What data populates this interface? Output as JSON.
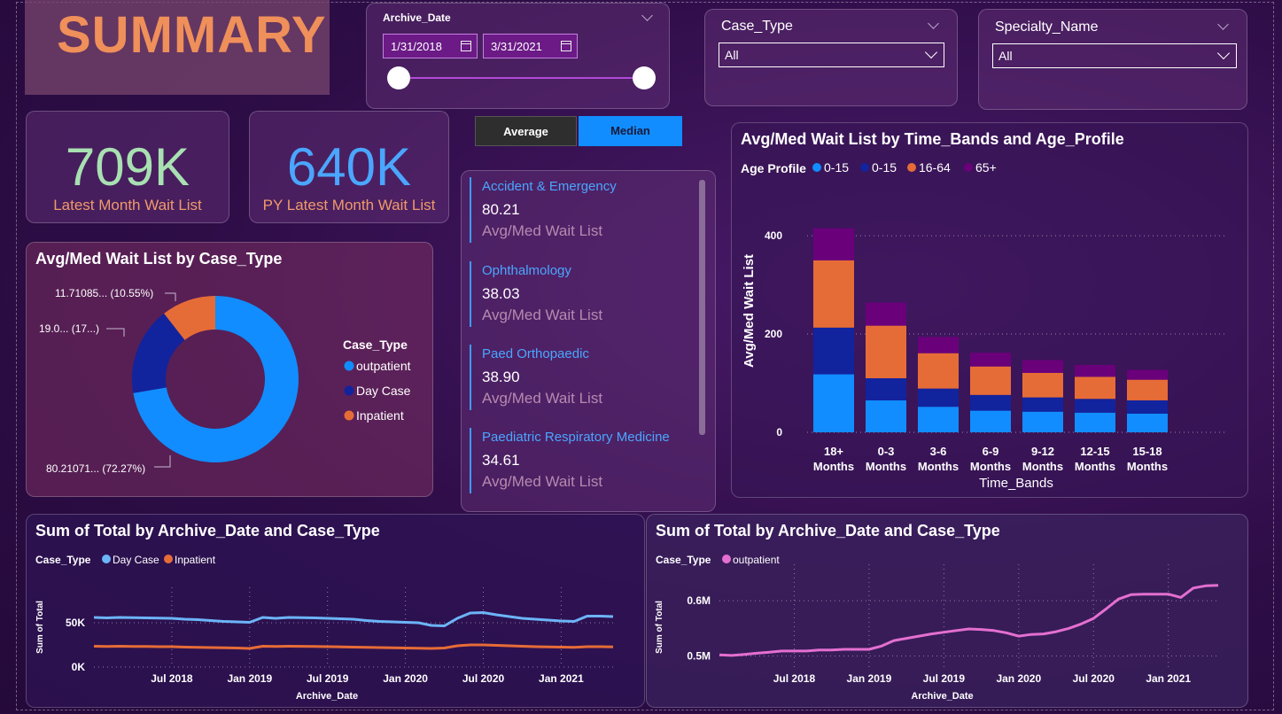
{
  "header": {
    "title": "SUMMARY"
  },
  "archive_slicer": {
    "title": "Archive_Date",
    "start": "1/31/2018",
    "end": "3/31/2021"
  },
  "case_type_slicer": {
    "title": "Case_Type",
    "value": "All"
  },
  "specialty_slicer": {
    "title": "Specialty_Name",
    "value": "All"
  },
  "kpis": [
    {
      "value": "709K",
      "label": "Latest Month Wait List",
      "color": "#a8e0b2"
    },
    {
      "value": "640K",
      "label": "PY Latest Month Wait List",
      "color": "#4aa6ff"
    }
  ],
  "toggle": {
    "average": "Average",
    "median": "Median"
  },
  "specialties": [
    {
      "name": "Accident & Emergency",
      "value": "80.21",
      "label": "Avg/Med Wait List"
    },
    {
      "name": "Ophthalmology",
      "value": "38.03",
      "label": "Avg/Med Wait List"
    },
    {
      "name": "Paed Orthopaedic",
      "value": "38.90",
      "label": "Avg/Med Wait List"
    },
    {
      "name": "Paediatric Respiratory Medicine",
      "value": "34.61",
      "label": "Avg/Med Wait List"
    }
  ],
  "colors": {
    "outpatient": "#118dff",
    "daycase": "#12239e",
    "inpatient": "#e66c37",
    "age65": "#6b007b",
    "daycase_line": "#6cb4f8",
    "outpatient_line": "#e46fd0"
  },
  "chart_data": [
    {
      "type": "pie",
      "title": "Avg/Med Wait List by Case_Type",
      "legend_title": "Case_Type",
      "legend_placement": "right",
      "slices": [
        {
          "name": "outpatient",
          "value": 80.21071,
          "label": "80.21071... (72.27%)"
        },
        {
          "name": "Day Case",
          "value": 19.0,
          "label": "19.0... (17...)"
        },
        {
          "name": "Inpatient",
          "value": 11.71085,
          "label": "11.71085... (10.55%)"
        }
      ]
    },
    {
      "type": "bar",
      "stacked": true,
      "title": "Avg/Med Wait List by Time_Bands and Age_Profile",
      "legend_title": "Age Profile",
      "legend_placement": "top-left",
      "xlabel": "Time_Bands",
      "ylabel": "Avg/Med Wait List",
      "ylim": [
        0,
        420
      ],
      "yticks": [
        0,
        200,
        400
      ],
      "categories": [
        "18+ Months",
        "0-3 Months",
        "3-6 Months",
        "6-9 Months",
        "9-12 Months",
        "12-15 Months",
        "15-18 Months"
      ],
      "series": [
        {
          "name": "0-15",
          "values": [
            118,
            65,
            52,
            44,
            42,
            40,
            38
          ]
        },
        {
          "name": "0-15",
          "values": [
            95,
            45,
            37,
            32,
            29,
            28,
            27
          ]
        },
        {
          "name": "16-64",
          "values": [
            137,
            107,
            72,
            58,
            50,
            45,
            42
          ]
        },
        {
          "name": "65+",
          "values": [
            65,
            47,
            33,
            28,
            26,
            24,
            20
          ]
        }
      ]
    },
    {
      "type": "line",
      "title": "Sum of Total by Archive_Date and Case_Type",
      "legend_title": "Case_Type",
      "legend_placement": "top-left",
      "xlabel": "Archive_Date",
      "ylabel": "Sum of Total",
      "x_range": [
        "2018-01",
        "2021-05"
      ],
      "ylim": [
        0,
        80000
      ],
      "yticks": [
        {
          "v": 0,
          "t": "0K"
        },
        {
          "v": 50000,
          "t": "50K"
        }
      ],
      "xticks": [
        {
          "d": "2018-07",
          "t": "Jul 2018"
        },
        {
          "d": "2019-01",
          "t": "Jan 2019"
        },
        {
          "d": "2019-07",
          "t": "Jul 2019"
        },
        {
          "d": "2020-01",
          "t": "Jan 2020"
        },
        {
          "d": "2020-07",
          "t": "Jul 2020"
        },
        {
          "d": "2021-01",
          "t": "Jan 2021"
        }
      ],
      "series": [
        {
          "name": "Day Case",
          "color": "#6cb4f8",
          "points": [
            [
              "2018-01",
              56000
            ],
            [
              "2018-02",
              55500
            ],
            [
              "2018-03",
              56000
            ],
            [
              "2018-04",
              55800
            ],
            [
              "2018-05",
              55500
            ],
            [
              "2018-06",
              55200
            ],
            [
              "2018-07",
              55000
            ],
            [
              "2018-08",
              54000
            ],
            [
              "2018-09",
              53500
            ],
            [
              "2018-10",
              52500
            ],
            [
              "2018-11",
              51500
            ],
            [
              "2018-12",
              51000
            ],
            [
              "2019-01",
              50500
            ],
            [
              "2019-02",
              56000
            ],
            [
              "2019-03",
              55000
            ],
            [
              "2019-04",
              56000
            ],
            [
              "2019-05",
              55800
            ],
            [
              "2019-06",
              55500
            ],
            [
              "2019-07",
              55000
            ],
            [
              "2019-08",
              54500
            ],
            [
              "2019-09",
              54000
            ],
            [
              "2019-10",
              52500
            ],
            [
              "2019-11",
              51500
            ],
            [
              "2019-12",
              51000
            ],
            [
              "2020-01",
              50500
            ],
            [
              "2020-02",
              50000
            ],
            [
              "2020-03",
              47000
            ],
            [
              "2020-04",
              46500
            ],
            [
              "2020-05",
              55000
            ],
            [
              "2020-06",
              61000
            ],
            [
              "2020-07",
              61500
            ],
            [
              "2020-08",
              59000
            ],
            [
              "2020-09",
              57000
            ],
            [
              "2020-10",
              55000
            ],
            [
              "2020-11",
              54000
            ],
            [
              "2020-12",
              53000
            ],
            [
              "2021-01",
              52000
            ],
            [
              "2021-02",
              51500
            ],
            [
              "2021-03",
              57500
            ],
            [
              "2021-04",
              57500
            ],
            [
              "2021-05",
              57000
            ]
          ]
        },
        {
          "name": "Inpatient",
          "color": "#e66c37",
          "points": [
            [
              "2018-01",
              23500
            ],
            [
              "2018-02",
              23300
            ],
            [
              "2018-03",
              23500
            ],
            [
              "2018-04",
              23200
            ],
            [
              "2018-05",
              23300
            ],
            [
              "2018-06",
              23000
            ],
            [
              "2018-07",
              23000
            ],
            [
              "2018-08",
              22500
            ],
            [
              "2018-09",
              22200
            ],
            [
              "2018-10",
              22000
            ],
            [
              "2018-11",
              21800
            ],
            [
              "2018-12",
              21500
            ],
            [
              "2019-01",
              21000
            ],
            [
              "2019-02",
              23500
            ],
            [
              "2019-03",
              23300
            ],
            [
              "2019-04",
              23500
            ],
            [
              "2019-05",
              23400
            ],
            [
              "2019-06",
              23200
            ],
            [
              "2019-07",
              23000
            ],
            [
              "2019-08",
              22800
            ],
            [
              "2019-09",
              22500
            ],
            [
              "2019-10",
              22200
            ],
            [
              "2019-11",
              22000
            ],
            [
              "2019-12",
              21800
            ],
            [
              "2020-01",
              21500
            ],
            [
              "2020-02",
              21200
            ],
            [
              "2020-03",
              21000
            ],
            [
              "2020-04",
              21500
            ],
            [
              "2020-05",
              24000
            ],
            [
              "2020-06",
              25000
            ],
            [
              "2020-07",
              25000
            ],
            [
              "2020-08",
              24500
            ],
            [
              "2020-09",
              24000
            ],
            [
              "2020-10",
              23500
            ],
            [
              "2020-11",
              23000
            ],
            [
              "2020-12",
              22800
            ],
            [
              "2021-01",
              22500
            ],
            [
              "2021-02",
              22300
            ],
            [
              "2021-03",
              23000
            ],
            [
              "2021-04",
              23000
            ],
            [
              "2021-05",
              22800
            ]
          ]
        }
      ]
    },
    {
      "type": "line",
      "title": "Sum of Total by Archive_Date and Case_Type",
      "legend_title": "Case_Type",
      "legend_placement": "top-left",
      "xlabel": "Archive_Date",
      "ylabel": "Sum of Total",
      "x_range": [
        "2018-01",
        "2021-05"
      ],
      "ylim": [
        0.48,
        0.65
      ],
      "yticks": [
        {
          "v": 0.5,
          "t": "0.5M"
        },
        {
          "v": 0.6,
          "t": "0.6M"
        }
      ],
      "xticks": [
        {
          "d": "2018-07",
          "t": "Jul 2018"
        },
        {
          "d": "2019-01",
          "t": "Jan 2019"
        },
        {
          "d": "2019-07",
          "t": "Jul 2019"
        },
        {
          "d": "2020-01",
          "t": "Jan 2020"
        },
        {
          "d": "2020-07",
          "t": "Jul 2020"
        },
        {
          "d": "2021-01",
          "t": "Jan 2021"
        }
      ],
      "series": [
        {
          "name": "outpatient",
          "color": "#e46fd0",
          "points": [
            [
              "2018-01",
              0.502
            ],
            [
              "2018-02",
              0.501
            ],
            [
              "2018-03",
              0.503
            ],
            [
              "2018-04",
              0.505
            ],
            [
              "2018-05",
              0.507
            ],
            [
              "2018-06",
              0.509
            ],
            [
              "2018-07",
              0.509
            ],
            [
              "2018-08",
              0.509
            ],
            [
              "2018-09",
              0.511
            ],
            [
              "2018-10",
              0.511
            ],
            [
              "2018-11",
              0.512
            ],
            [
              "2018-12",
              0.512
            ],
            [
              "2019-01",
              0.512
            ],
            [
              "2019-02",
              0.518
            ],
            [
              "2019-03",
              0.528
            ],
            [
              "2019-04",
              0.532
            ],
            [
              "2019-05",
              0.536
            ],
            [
              "2019-06",
              0.54
            ],
            [
              "2019-07",
              0.543
            ],
            [
              "2019-08",
              0.546
            ],
            [
              "2019-09",
              0.549
            ],
            [
              "2019-10",
              0.548
            ],
            [
              "2019-11",
              0.546
            ],
            [
              "2019-12",
              0.542
            ],
            [
              "2020-01",
              0.536
            ],
            [
              "2020-02",
              0.539
            ],
            [
              "2020-03",
              0.54
            ],
            [
              "2020-04",
              0.544
            ],
            [
              "2020-05",
              0.55
            ],
            [
              "2020-06",
              0.558
            ],
            [
              "2020-07",
              0.568
            ],
            [
              "2020-08",
              0.585
            ],
            [
              "2020-09",
              0.603
            ],
            [
              "2020-10",
              0.611
            ],
            [
              "2020-11",
              0.612
            ],
            [
              "2020-12",
              0.612
            ],
            [
              "2021-01",
              0.612
            ],
            [
              "2021-02",
              0.606
            ],
            [
              "2021-03",
              0.623
            ],
            [
              "2021-04",
              0.627
            ],
            [
              "2021-05",
              0.628
            ]
          ]
        }
      ]
    }
  ]
}
